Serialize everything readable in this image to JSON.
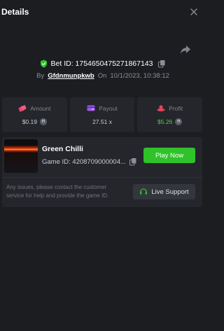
{
  "header": {
    "title": "Details"
  },
  "bet": {
    "id_label": "Bet ID: 1754650475271867143",
    "by_label": "By",
    "username": "Gfdnmunpkwb",
    "on_label": "On",
    "datetime": "10/1/2023, 10:38:12"
  },
  "stats": [
    {
      "label": "Amount",
      "value": "$0.19",
      "icon": "coins-icon",
      "color": "#e0456a",
      "coin": true
    },
    {
      "label": "Payout",
      "value": "27.51 x",
      "icon": "payout-icon",
      "color": "#9b59e8",
      "coin": false
    },
    {
      "label": "Profit",
      "value": "$5.26",
      "icon": "profit-icon",
      "color": "#e0455a",
      "coin": true,
      "value_color": "#4fd14a"
    }
  ],
  "game": {
    "name": "Green Chilli",
    "id_label": "Game ID: 4208709000004...",
    "play_label": "Play Now"
  },
  "support": {
    "help_text": "Any issues, please contact the customer service for help and provide the game ID.",
    "button_label": "Live Support"
  },
  "colors": {
    "accent_green": "#2fc22a",
    "background": "#1b1d21",
    "card": "#24262b"
  }
}
